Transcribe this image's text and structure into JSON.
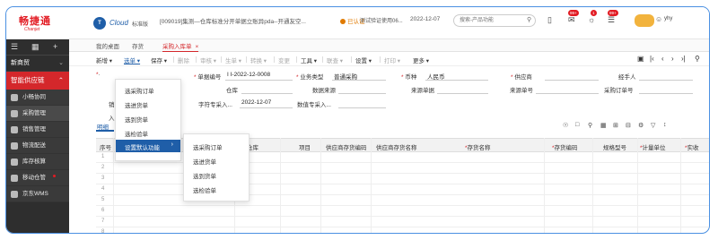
{
  "header": {
    "brand": "畅捷通",
    "brand_sub": "Chanjet",
    "product_logo": "T",
    "product": "Cloud",
    "edition": "标准版",
    "account": "[009019]集测—仓库标准分开单据立账异pda--开通友空...",
    "cert": "已认证",
    "demo": "测试验证使用06...",
    "date": "2022-12-07",
    "search_placeholder": "搜索-产品功能",
    "badges": [
      "99+",
      "1",
      "99+"
    ],
    "user": "yhy"
  },
  "sidebar": {
    "top_icons": [
      "menu-icon",
      "grid-icon",
      "add-icon"
    ],
    "new_items": "新商贸",
    "group": "智能供应链",
    "items": [
      {
        "label": "小畅协同"
      },
      {
        "label": "采购管理"
      },
      {
        "label": "销售管理"
      },
      {
        "label": "物流配送"
      },
      {
        "label": "库存核算"
      },
      {
        "label": "移动仓管"
      },
      {
        "label": "京东WMS"
      }
    ]
  },
  "tabs": [
    {
      "label": "我的桌面"
    },
    {
      "label": "存货"
    },
    {
      "label": "采购入库单",
      "close": "×"
    }
  ],
  "toolbar": {
    "new": "新增",
    "select": "选单",
    "save": "保存",
    "delete": "删除",
    "audit": "审核",
    "generate": "生单",
    "convert": "转换",
    "change": "变更",
    "tools": "工具",
    "query": "联查",
    "settings": "设置",
    "print": "打印",
    "more": "更多"
  },
  "form": {
    "doc_no_label": "单据编号",
    "doc_no": "I I-2022-12-0008",
    "biz_type_label": "业务类型",
    "biz_type": "普通采购",
    "currency_label": "币种",
    "currency": "人民币",
    "supplier_label": "供应商",
    "handler_label": "经手人",
    "warehouse_label": "仓库",
    "source_label": "数据来源",
    "source_doc_label": "来源单据",
    "source_no_label": "来源单号",
    "po_no_label": "采购订单号",
    "partial_label_a": "销",
    "partial_label_b": "入",
    "field1_label": "字符专采入...",
    "field1": "2022-12-07",
    "field2_label": "数值专采入..."
  },
  "subtab": "明细",
  "table": {
    "headers": [
      {
        "label": "序号"
      },
      {
        "label": "仓库",
        "partial": true
      },
      {
        "label": "项目"
      },
      {
        "label": "供应商存货编码"
      },
      {
        "label": "供应商存货名称"
      },
      {
        "label": "存货名称",
        "required": true
      },
      {
        "label": "存货编码",
        "required": true
      },
      {
        "label": "规格型号"
      },
      {
        "label": "计量单位",
        "required": true
      },
      {
        "label": "实收",
        "required": true
      }
    ],
    "rows": [
      "1",
      "2",
      "3",
      "4",
      "5",
      "6",
      "7",
      "8"
    ]
  },
  "select_menu": {
    "items": [
      "选采购订单",
      "选进货单",
      "选到货单",
      "选检验单",
      "设置默认功能"
    ],
    "highlighted": 4
  },
  "default_submenu": {
    "items": [
      "选采购订单",
      "选进货单",
      "选到货单",
      "选检验单"
    ]
  },
  "colors": {
    "accent": "#d4272b",
    "link": "#1f5ea8",
    "frame": "#4a90e2"
  }
}
